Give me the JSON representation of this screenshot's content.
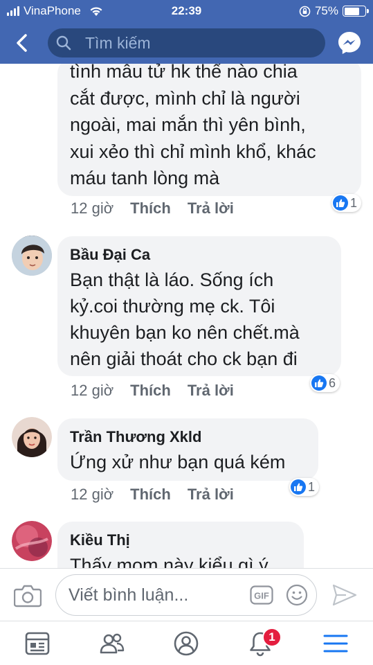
{
  "status_bar": {
    "carrier": "VinaPhone",
    "time": "22:39",
    "battery_percent": "75%",
    "battery_level": 0.75
  },
  "navbar": {
    "search_placeholder": "Tìm kiếm",
    "back_icon": "chevron-left-icon",
    "messenger_icon": "messenger-icon"
  },
  "comments": [
    {
      "author": "",
      "text": "tình mẫu tử hk thế nào chia\ncắt được,  mình chỉ là người\nngoài, mai mắn thì yên bình,\nxui xẻo thì chỉ mình khổ, khác\nmáu tanh lòng mà",
      "time": "12 giờ",
      "like_label": "Thích",
      "reply_label": "Trả lời",
      "reactions": "1"
    },
    {
      "author": "Bầu Đại Ca",
      "text": "Bạn thật  là láo. Sống ích\nkỷ.coi thường mẹ ck. Tôi\nkhuyên bạn ko nên chết.mà\nnên giải thoát cho ck bạn đi",
      "time": "12 giờ",
      "like_label": "Thích",
      "reply_label": "Trả lời",
      "reactions": "6"
    },
    {
      "author": "Trần Thương Xkld",
      "text": "Ứng xử như bạn quá kém",
      "time": "12 giờ",
      "like_label": "Thích",
      "reply_label": "Trả lời",
      "reactions": "1"
    },
    {
      "author": "Kiều Thị",
      "text": "Thấy mom này kiểu gì ý",
      "time": "",
      "like_label": "",
      "reply_label": "",
      "reactions": ""
    }
  ],
  "compose": {
    "placeholder": "Viết bình luận...",
    "gif_label": "GIF"
  },
  "tabbar": {
    "notifications_count": "1",
    "tabs": [
      "news-feed-icon",
      "groups-icon",
      "profile-icon",
      "notifications-icon",
      "menu-icon"
    ]
  },
  "colors": {
    "facebook_blue": "#4267b2",
    "search_bg": "#29487d",
    "bubble_bg": "#f2f3f5",
    "like_blue": "#1877f2",
    "badge_red": "#e41e3f",
    "menu_active": "#1877f2"
  }
}
